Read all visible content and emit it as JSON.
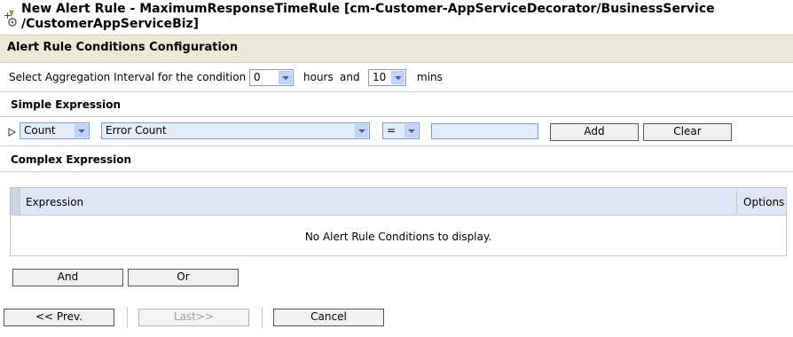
{
  "header": {
    "title_line1": "New Alert Rule - MaximumResponseTimeRule [cm-Customer-AppServiceDecorator/BusinessService",
    "title_line2": "/CustomerAppServiceBiz]",
    "icon": "alert-rule-icon"
  },
  "section": {
    "title": "Alert Rule Conditions Configuration"
  },
  "aggregation": {
    "label": "Select Aggregation Interval for the condition :",
    "hours_value": "0",
    "hours_label": "hours",
    "and_label": "and",
    "mins_value": "10",
    "mins_label": "mins"
  },
  "simple": {
    "heading": "Simple Expression",
    "function_value": "Count",
    "metric_value": "Error Count",
    "operator_value": "=",
    "value_input": "",
    "add_label": "Add",
    "clear_label": "Clear"
  },
  "complex": {
    "heading": "Complex Expression",
    "columns": [
      "Expression",
      "Options"
    ],
    "empty_message": "No Alert Rule Conditions to display.",
    "and_label": "And",
    "or_label": "Or"
  },
  "footer": {
    "prev_label": "<< Prev.",
    "last_label": "Last>>",
    "cancel_label": "Cancel"
  },
  "colors": {
    "band": "#ece9d8",
    "table_header": "#dfe6f5",
    "select_blue": "#e3ecfb"
  }
}
